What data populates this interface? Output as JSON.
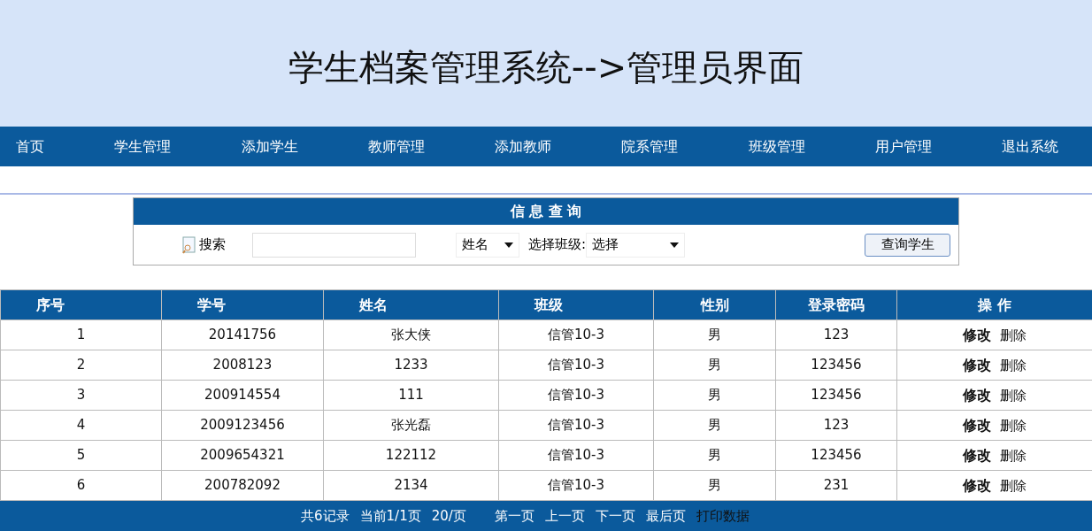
{
  "header": {
    "title": "学生档案管理系统-->管理员界面"
  },
  "nav": [
    "首页",
    "学生管理",
    "添加学生",
    "教师管理",
    "添加教师",
    "院系管理",
    "班级管理",
    "用户管理",
    "退出系统"
  ],
  "query_panel": {
    "title": "信 息 查 询",
    "search_label": "搜索",
    "field_select": "姓名",
    "class_label": "选择班级:",
    "class_select": "选择",
    "button": "查询学生"
  },
  "table": {
    "columns": [
      "序号",
      "学号",
      "姓名",
      "班级",
      "性别",
      "登录密码",
      "操 作"
    ],
    "rows": [
      {
        "cells": [
          "1",
          "20141756",
          "张大侠",
          "信管10-3",
          "男",
          "123"
        ],
        "actions": [
          {
            "label": "修改",
            "kind": "edit"
          },
          {
            "label": "删除",
            "kind": "delete"
          }
        ]
      },
      {
        "cells": [
          "2",
          "2008123",
          "1233",
          "信管10-3",
          "男",
          "123456"
        ],
        "actions": [
          {
            "label": "修改",
            "kind": "edit"
          },
          {
            "label": "删除",
            "kind": "delete"
          }
        ]
      },
      {
        "cells": [
          "3",
          "200914554",
          "111",
          "信管10-3",
          "男",
          "123456"
        ],
        "actions": [
          {
            "label": "修改",
            "kind": "edit"
          },
          {
            "label": "删除",
            "kind": "delete"
          }
        ]
      },
      {
        "cells": [
          "4",
          "2009123456",
          "张光磊",
          "信管10-3",
          "男",
          "123"
        ],
        "actions": [
          {
            "label": "修改",
            "kind": "edit"
          },
          {
            "label": "删除",
            "kind": "delete"
          }
        ]
      },
      {
        "cells": [
          "5",
          "2009654321",
          "122112",
          "信管10-3",
          "男",
          "123456"
        ],
        "actions": [
          {
            "label": "修改",
            "kind": "edit"
          },
          {
            "label": "删除",
            "kind": "delete"
          }
        ]
      },
      {
        "cells": [
          "6",
          "200782092",
          "2134",
          "信管10-3",
          "男",
          "231"
        ],
        "actions": [
          {
            "label": "修改",
            "kind": "edit"
          },
          {
            "label": "删除",
            "kind": "delete"
          }
        ]
      }
    ]
  },
  "pager": [
    {
      "label": "共6记录",
      "kind": "info"
    },
    {
      "label": "当前1/1页",
      "kind": "info"
    },
    {
      "label": "20/页",
      "kind": "info"
    },
    {
      "label": "第一页",
      "kind": "link"
    },
    {
      "label": "上一页",
      "kind": "link"
    },
    {
      "label": "下一页",
      "kind": "link"
    },
    {
      "label": "最后页",
      "kind": "link"
    },
    {
      "label": "打印数据",
      "kind": "print"
    }
  ]
}
